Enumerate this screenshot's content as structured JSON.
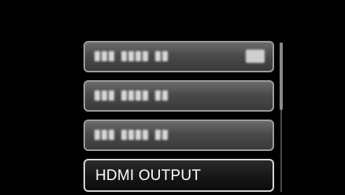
{
  "menu": {
    "items": [
      {
        "label": "",
        "blurred": true,
        "has_badge": true
      },
      {
        "label": "",
        "blurred": true,
        "has_badge": false
      },
      {
        "label": "",
        "blurred": true,
        "has_badge": false
      },
      {
        "label": "HDMI OUTPUT",
        "selected": true
      }
    ]
  },
  "colors": {
    "background": "#000000",
    "item_border": "#9c9c9c",
    "selected_border": "#d6d6d6",
    "text": "#ffffff"
  },
  "icons": {
    "scrollbar": "vertical-scrollbar"
  }
}
